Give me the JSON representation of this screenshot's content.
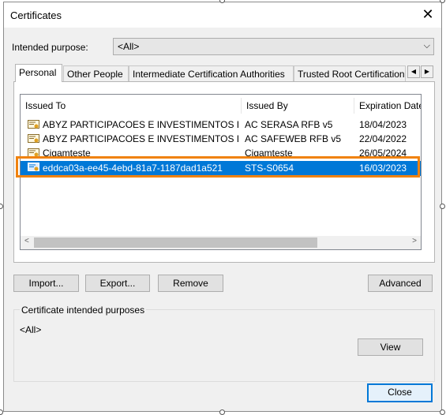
{
  "dialog": {
    "title": "Certificates",
    "close_glyph": "✕"
  },
  "purpose": {
    "label": "Intended purpose:",
    "value": "<All>",
    "arrow_glyph": "⌵"
  },
  "tabs": [
    {
      "label": "Personal",
      "active": true
    },
    {
      "label": "Other People",
      "active": false
    },
    {
      "label": "Intermediate Certification Authorities",
      "active": false
    },
    {
      "label": "Trusted Root Certification",
      "active": false
    }
  ],
  "tab_scroll": {
    "left": "◀",
    "right": "▶"
  },
  "columns": [
    "Issued To",
    "Issued By",
    "Expiration Date"
  ],
  "rows": [
    {
      "issued_to": "ABYZ PARTICIPACOES E INVESTIMENTOS L...",
      "issued_by": "AC SERASA RFB v5",
      "expiration": "18/04/2023",
      "selected": false
    },
    {
      "issued_to": "ABYZ PARTICIPACOES E INVESTIMENTOS L...",
      "issued_by": "AC SAFEWEB RFB v5",
      "expiration": "22/04/2022",
      "selected": false
    },
    {
      "issued_to": "Cigamteste",
      "issued_by": "Cigamteste",
      "expiration": "26/05/2024",
      "selected": false
    },
    {
      "issued_to": "eddca03a-ee45-4ebd-81a7-1187dad1a521",
      "issued_by": "STS-S0654",
      "expiration": "16/03/2023",
      "selected": true
    }
  ],
  "scrollbar": {
    "left": "<",
    "right": ">"
  },
  "buttons": {
    "import": "Import...",
    "export": "Export...",
    "remove": "Remove",
    "advanced": "Advanced",
    "view": "View",
    "close": "Close"
  },
  "intended_purposes": {
    "label": "Certificate intended purposes",
    "value": "<All>"
  },
  "colors": {
    "selection": "#0078d7",
    "highlight_box": "#f0820f"
  }
}
